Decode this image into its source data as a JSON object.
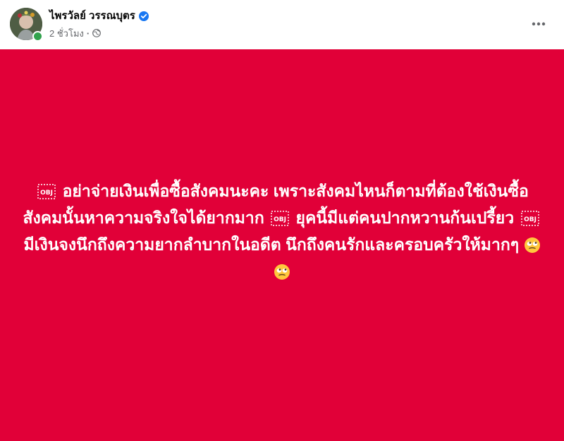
{
  "post": {
    "author_name": "ไพรวัลย์ วรรณบุตร",
    "timestamp": "2 ชั่วโมง",
    "meta_separator": "·",
    "privacy_icon": "globe-icon",
    "verified_icon": "verified-badge-icon",
    "more_icon": "more-horizontal-icon",
    "status": "online"
  },
  "content": {
    "background_color": "#e10038",
    "text_color": "#ffffff",
    "segments": {
      "s1": "อย่าจ่ายเงินเพื่อซื้อสังคมนะคะ เพราะสังคมไหนก็ตามที่ต้องใช้เงินซื้อ สังคมนั้นหาความจริงใจได้ยากมาก",
      "s2": "ยุคนี้มีแต่คนปากหวานก้นเปรี้ยว",
      "s3": "มีเงินจงนึกถึงความยากลำบากในอดีต นึกถึงคนรักและครอบครัวให้มากๆ"
    },
    "inline_icons": [
      "obj-icon",
      "obj-icon",
      "obj-icon",
      "eye-roll-emoji-icon",
      "eye-roll-emoji-icon"
    ]
  },
  "colors": {
    "verified": "#1877f2",
    "online": "#31a24c",
    "meta_text": "#65676b"
  }
}
